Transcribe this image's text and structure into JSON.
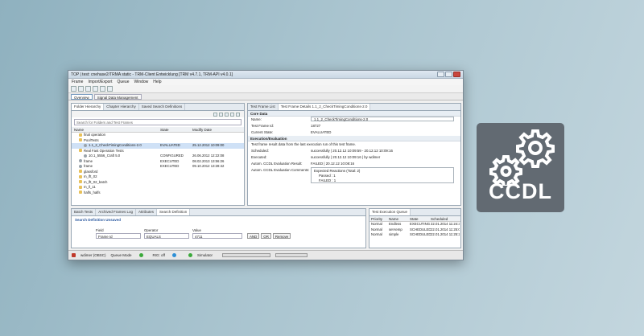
{
  "window": {
    "title": "TOP | test: cnehase2/TRMA static - TRM-Client Entwicklung [TRM v4.7.1, TRM-API v4.0.1]",
    "menu": [
      "Frame",
      "Import/Export",
      "Queue",
      "Window",
      "Help"
    ],
    "perspectives": [
      "Overview",
      "Signal Data Management"
    ]
  },
  "left_panel": {
    "tabs": [
      "Folder Hierarchy",
      "Chapter Hierarchy",
      "Saved Search Definitions"
    ],
    "search_placeholder": "Search for Folders and Test Frames",
    "columns": [
      "Name",
      "State",
      "Modify Date"
    ],
    "rows": [
      {
        "name": "final operation",
        "state": "",
        "date": "",
        "indent": 1,
        "icon": "folder"
      },
      {
        "name": "PoolTests",
        "state": "",
        "date": "",
        "indent": 1,
        "icon": "folder"
      },
      {
        "name": "1.1_2_CheckTimingConditions-2.0",
        "state": "EVALUATED",
        "date": "25.12.2012 10:09:00",
        "indent": 2,
        "icon": "gear",
        "selected": true
      },
      {
        "name": "Real Fast Operation Tests",
        "state": "",
        "date": "",
        "indent": 1,
        "icon": "folder"
      },
      {
        "name": "10.1_5556_Craft 5.0",
        "state": "CONFIGURED",
        "date": "26.06.2012 12:22:08",
        "indent": 2,
        "icon": "gear"
      },
      {
        "name": "frame",
        "state": "EXECUTED",
        "date": "08.02.2013 13:56:26",
        "indent": 1,
        "icon": "gear"
      },
      {
        "name": "frame",
        "state": "EXECUTED",
        "date": "09.10.2012 13:28:42",
        "indent": 1,
        "icon": "gear"
      },
      {
        "name": "glassford",
        "state": "",
        "date": "",
        "indent": 1,
        "icon": "folder"
      },
      {
        "name": "m_lft_02",
        "state": "",
        "date": "",
        "indent": 1,
        "icon": "folder"
      },
      {
        "name": "m_lft_02_batch",
        "state": "",
        "date": "",
        "indent": 1,
        "icon": "folder"
      },
      {
        "name": "m_ll_11",
        "state": "",
        "date": "",
        "indent": 1,
        "icon": "folder"
      },
      {
        "name": "halfs_halfs",
        "state": "",
        "date": "",
        "indent": 1,
        "icon": "folder"
      }
    ]
  },
  "right_panel": {
    "tabs": [
      "Test Frame List",
      "Test Frame Details 1.1_2_CheckTimingConditions-2.0"
    ],
    "core_data": {
      "title": "Core Data",
      "name_label": "Name:",
      "name_value": "1.1_2_CheckTimingConditions-2.0",
      "id_label": "Test Frame Id:",
      "id_value": "18727",
      "state_label": "Current State:",
      "state_value": "EVALUATED"
    },
    "execution": {
      "title": "Execution/Evaluation",
      "description": "Test frame result data from the last execution run of this test frame.",
      "scheduled_label": "Scheduled:",
      "scheduled_value": "successfully | 20.12.12 10:09:59 - 20.12.12 10:09:16",
      "executed_label": "Executed:",
      "executed_value": "successfully | 20.12.12 10:09:16 | by wdimer",
      "autom_result_label": "Autom. CCDL Evaluation Result:",
      "autom_result_value": "FAILED | 20.12.12 10:08:16",
      "comments_label": "Autom. CCDL Evaluation Comments:",
      "comments_lines": [
        "Expected Reactions (Total: 2)",
        "Passed   :   1",
        "FAILED  :   1"
      ]
    }
  },
  "bottom_left": {
    "tabs": [
      "Batch Tests",
      "Archived Frames Log",
      "Attributes",
      "Search Definition"
    ],
    "heading": "Search Definition Unsaved",
    "col_field": "Field",
    "col_operator": "Operator",
    "col_value": "Value",
    "field_value": "Frame Id",
    "operator_value": "EQUALS",
    "value_value": "4711",
    "and_label": "AND",
    "or_label": "OR",
    "remove_label": "Remove"
  },
  "bottom_right": {
    "tab": "Test Execution Queue",
    "columns": [
      "Priority",
      "Name",
      "State",
      "Scheduled"
    ],
    "rows": [
      {
        "priority": "Normal",
        "name": "Endless",
        "state": "EXECUTING",
        "scheduled": "22.01.2014 11:24:38"
      },
      {
        "priority": "Normal",
        "name": "set-temp",
        "state": "SCHEDULED",
        "scheduled": "22.01.2014 11:25:00"
      },
      {
        "priority": "Normal",
        "name": "simple",
        "state": "SCHEDULED",
        "scheduled": "22.01.2014 11:25:22"
      }
    ]
  },
  "status_bar": {
    "user": "wdimer (OBSC)",
    "queue_mode": "Queue Mode",
    "rig": "RIG: off",
    "simulator": "Simulator",
    "queue_color": "#3ba93b",
    "sim_color": "#3ba93b",
    "rig_color": "#2d8fd6"
  },
  "logo": {
    "text": "CCDL",
    "color": "#626a72"
  }
}
